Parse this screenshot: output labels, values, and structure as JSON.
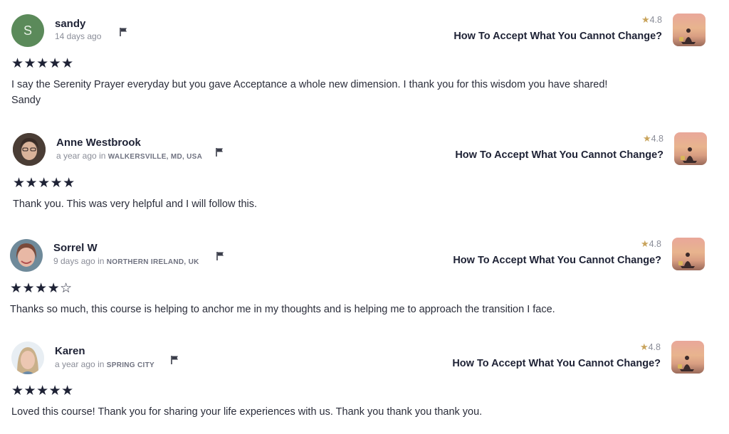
{
  "reviews": [
    {
      "avatar_letter": "S",
      "name": "sandy",
      "time": "14 days ago",
      "location": "",
      "stars": "★★★★★",
      "text_lines": [
        "I say the Serenity Prayer everyday but you gave Acceptance a whole new dimension. I thank you for this wisdom you have shared!",
        "Sandy"
      ],
      "course_rating": "4.8",
      "course_title": "How To Accept What You Cannot Change?"
    },
    {
      "avatar_letter": "",
      "name": "Anne Westbrook",
      "time": "a year ago",
      "in_label": "in",
      "location": "WALKERSVILLE, MD, USA",
      "stars": "★★★★★",
      "text_lines": [
        "Thank you. This was very helpful and I will follow this."
      ],
      "course_rating": "4.8",
      "course_title": "How To Accept What You Cannot Change?"
    },
    {
      "avatar_letter": "",
      "name": "Sorrel W",
      "time": "9 days ago",
      "in_label": "in",
      "location": "NORTHERN IRELAND, UK",
      "stars": "★★★★☆",
      "text_lines": [
        "Thanks so much, this course is helping to anchor me in my thoughts and is helping me to approach the transition I face."
      ],
      "course_rating": "4.8",
      "course_title": "How To Accept What You Cannot Change?"
    },
    {
      "avatar_letter": "",
      "name": "Karen",
      "time": "a year ago",
      "in_label": "in",
      "location": "SPRING CITY",
      "stars": "★★★★★",
      "text_lines": [
        "Loved this course! Thank you for sharing your life experiences with us. Thank you thank you thank you."
      ],
      "course_rating": "4.8",
      "course_title": "How To Accept What You Cannot Change?"
    }
  ],
  "colors": {
    "star_rating": "#c9a45c",
    "avatar_green": "#5b8a5a",
    "text_dark": "#1e2235"
  },
  "icons": {
    "flag": "flag-icon",
    "rating_star": "star-icon"
  }
}
